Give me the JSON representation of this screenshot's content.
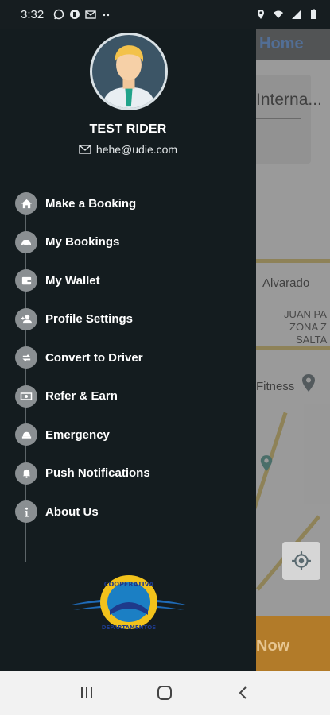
{
  "status_bar": {
    "time": "3:32",
    "left_icons": [
      "whatsapp-icon",
      "app-icon",
      "mail-icon",
      "dots-icon"
    ],
    "right_icons": [
      "location-icon",
      "wifi-icon",
      "signal-icon",
      "battery-icon"
    ]
  },
  "map": {
    "header_title": "Home",
    "search_text": "Interna...",
    "labels": {
      "alvarado": "Alvarado",
      "juan": "JUAN PA",
      "zona": "ZONA Z",
      "salta": "SALTA",
      "fitness": "Fitness"
    },
    "book_label": "Now"
  },
  "drawer": {
    "user_name": "TEST RIDER",
    "user_email": "hehe@udie.com",
    "menu": [
      {
        "label": "Make a Booking",
        "icon": "home-icon"
      },
      {
        "label": "My Bookings",
        "icon": "car-icon"
      },
      {
        "label": "My Wallet",
        "icon": "wallet-icon"
      },
      {
        "label": "Profile Settings",
        "icon": "profile-icon"
      },
      {
        "label": "Convert to Driver",
        "icon": "swap-icon"
      },
      {
        "label": "Refer & Earn",
        "icon": "money-icon"
      },
      {
        "label": "Emergency",
        "icon": "emergency-icon"
      },
      {
        "label": "Push Notifications",
        "icon": "bell-icon"
      },
      {
        "label": "About Us",
        "icon": "info-icon"
      }
    ],
    "logo_text_top": "COOPERATIVA",
    "logo_text_bottom": "DEPARTAMENTOS"
  },
  "nav_bar": {
    "buttons": [
      "recent-apps-icon",
      "home-circle-icon",
      "back-icon"
    ]
  },
  "colors": {
    "drawer_bg": "#141c1f",
    "icon_bg": "#8a8f92",
    "accent_blue": "#5b8fd6",
    "book_orange": "#b27b29"
  }
}
